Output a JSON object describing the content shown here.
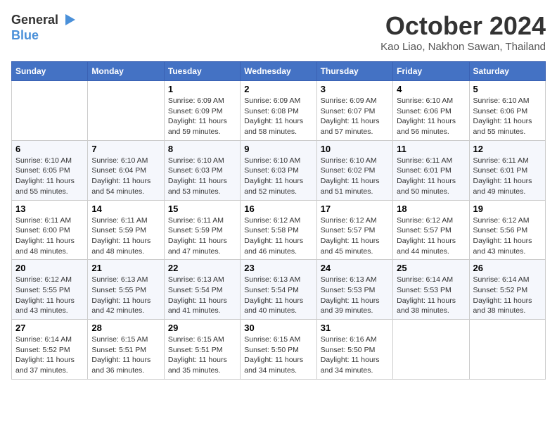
{
  "header": {
    "logo_general": "General",
    "logo_blue": "Blue",
    "month": "October 2024",
    "location": "Kao Liao, Nakhon Sawan, Thailand"
  },
  "days_of_week": [
    "Sunday",
    "Monday",
    "Tuesday",
    "Wednesday",
    "Thursday",
    "Friday",
    "Saturday"
  ],
  "weeks": [
    [
      {
        "day": "",
        "info": ""
      },
      {
        "day": "",
        "info": ""
      },
      {
        "day": "1",
        "info": "Sunrise: 6:09 AM\nSunset: 6:09 PM\nDaylight: 11 hours and 59 minutes."
      },
      {
        "day": "2",
        "info": "Sunrise: 6:09 AM\nSunset: 6:08 PM\nDaylight: 11 hours and 58 minutes."
      },
      {
        "day": "3",
        "info": "Sunrise: 6:09 AM\nSunset: 6:07 PM\nDaylight: 11 hours and 57 minutes."
      },
      {
        "day": "4",
        "info": "Sunrise: 6:10 AM\nSunset: 6:06 PM\nDaylight: 11 hours and 56 minutes."
      },
      {
        "day": "5",
        "info": "Sunrise: 6:10 AM\nSunset: 6:06 PM\nDaylight: 11 hours and 55 minutes."
      }
    ],
    [
      {
        "day": "6",
        "info": "Sunrise: 6:10 AM\nSunset: 6:05 PM\nDaylight: 11 hours and 55 minutes."
      },
      {
        "day": "7",
        "info": "Sunrise: 6:10 AM\nSunset: 6:04 PM\nDaylight: 11 hours and 54 minutes."
      },
      {
        "day": "8",
        "info": "Sunrise: 6:10 AM\nSunset: 6:03 PM\nDaylight: 11 hours and 53 minutes."
      },
      {
        "day": "9",
        "info": "Sunrise: 6:10 AM\nSunset: 6:03 PM\nDaylight: 11 hours and 52 minutes."
      },
      {
        "day": "10",
        "info": "Sunrise: 6:10 AM\nSunset: 6:02 PM\nDaylight: 11 hours and 51 minutes."
      },
      {
        "day": "11",
        "info": "Sunrise: 6:11 AM\nSunset: 6:01 PM\nDaylight: 11 hours and 50 minutes."
      },
      {
        "day": "12",
        "info": "Sunrise: 6:11 AM\nSunset: 6:01 PM\nDaylight: 11 hours and 49 minutes."
      }
    ],
    [
      {
        "day": "13",
        "info": "Sunrise: 6:11 AM\nSunset: 6:00 PM\nDaylight: 11 hours and 48 minutes."
      },
      {
        "day": "14",
        "info": "Sunrise: 6:11 AM\nSunset: 5:59 PM\nDaylight: 11 hours and 48 minutes."
      },
      {
        "day": "15",
        "info": "Sunrise: 6:11 AM\nSunset: 5:59 PM\nDaylight: 11 hours and 47 minutes."
      },
      {
        "day": "16",
        "info": "Sunrise: 6:12 AM\nSunset: 5:58 PM\nDaylight: 11 hours and 46 minutes."
      },
      {
        "day": "17",
        "info": "Sunrise: 6:12 AM\nSunset: 5:57 PM\nDaylight: 11 hours and 45 minutes."
      },
      {
        "day": "18",
        "info": "Sunrise: 6:12 AM\nSunset: 5:57 PM\nDaylight: 11 hours and 44 minutes."
      },
      {
        "day": "19",
        "info": "Sunrise: 6:12 AM\nSunset: 5:56 PM\nDaylight: 11 hours and 43 minutes."
      }
    ],
    [
      {
        "day": "20",
        "info": "Sunrise: 6:12 AM\nSunset: 5:55 PM\nDaylight: 11 hours and 43 minutes."
      },
      {
        "day": "21",
        "info": "Sunrise: 6:13 AM\nSunset: 5:55 PM\nDaylight: 11 hours and 42 minutes."
      },
      {
        "day": "22",
        "info": "Sunrise: 6:13 AM\nSunset: 5:54 PM\nDaylight: 11 hours and 41 minutes."
      },
      {
        "day": "23",
        "info": "Sunrise: 6:13 AM\nSunset: 5:54 PM\nDaylight: 11 hours and 40 minutes."
      },
      {
        "day": "24",
        "info": "Sunrise: 6:13 AM\nSunset: 5:53 PM\nDaylight: 11 hours and 39 minutes."
      },
      {
        "day": "25",
        "info": "Sunrise: 6:14 AM\nSunset: 5:53 PM\nDaylight: 11 hours and 38 minutes."
      },
      {
        "day": "26",
        "info": "Sunrise: 6:14 AM\nSunset: 5:52 PM\nDaylight: 11 hours and 38 minutes."
      }
    ],
    [
      {
        "day": "27",
        "info": "Sunrise: 6:14 AM\nSunset: 5:52 PM\nDaylight: 11 hours and 37 minutes."
      },
      {
        "day": "28",
        "info": "Sunrise: 6:15 AM\nSunset: 5:51 PM\nDaylight: 11 hours and 36 minutes."
      },
      {
        "day": "29",
        "info": "Sunrise: 6:15 AM\nSunset: 5:51 PM\nDaylight: 11 hours and 35 minutes."
      },
      {
        "day": "30",
        "info": "Sunrise: 6:15 AM\nSunset: 5:50 PM\nDaylight: 11 hours and 34 minutes."
      },
      {
        "day": "31",
        "info": "Sunrise: 6:16 AM\nSunset: 5:50 PM\nDaylight: 11 hours and 34 minutes."
      },
      {
        "day": "",
        "info": ""
      },
      {
        "day": "",
        "info": ""
      }
    ]
  ]
}
